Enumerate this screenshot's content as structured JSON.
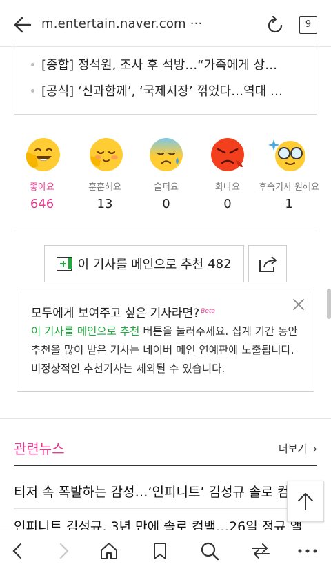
{
  "browser": {
    "url": "m.entertain.naver.com ···",
    "tab_count": "9"
  },
  "related_top": [
    {
      "text": "[종합] 정석원, 조사 후 석방…“가족에게 상…"
    },
    {
      "text": "[공식] ‘신과함께’, ‘국제시장’ 꺾었다…역대 …"
    }
  ],
  "reactions": [
    {
      "label": "좋아요",
      "count": "646",
      "icon": "smiling-face-icon"
    },
    {
      "label": "훈훈해요",
      "count": "13",
      "icon": "warm-face-icon"
    },
    {
      "label": "슬퍼요",
      "count": "0",
      "icon": "sad-face-icon"
    },
    {
      "label": "화나요",
      "count": "0",
      "icon": "angry-face-icon"
    },
    {
      "label": "후속기사 원해요",
      "count": "1",
      "icon": "glasses-face-icon"
    }
  ],
  "recommend": {
    "label": "이 기사를 메인으로 추천",
    "count": "482"
  },
  "info": {
    "title": "모두에게 보여주고 싶은 기사라면?",
    "beta": "Beta",
    "highlight": "이 기사를 메인으로 추천",
    "body": " 버튼을 눌러주세요. 집계 기간 동안 추천을 많이 받은 기사는 네이버 메인 연예판에 노출됩니다. 비정상적인 추천기사는 제외될 수 있습니다."
  },
  "related_news": {
    "title": "관련뉴스",
    "more": "더보기",
    "items": [
      "티저 속 폭발하는 감성…‘인피니트’ 김성규 솔로 컴",
      "인피니트 김성규, 3년 만에 솔로 컴백…26일 정규 앨"
    ]
  },
  "colors": {
    "accent_pink": "#e53b8e",
    "accent_green": "#1eaa3c"
  }
}
